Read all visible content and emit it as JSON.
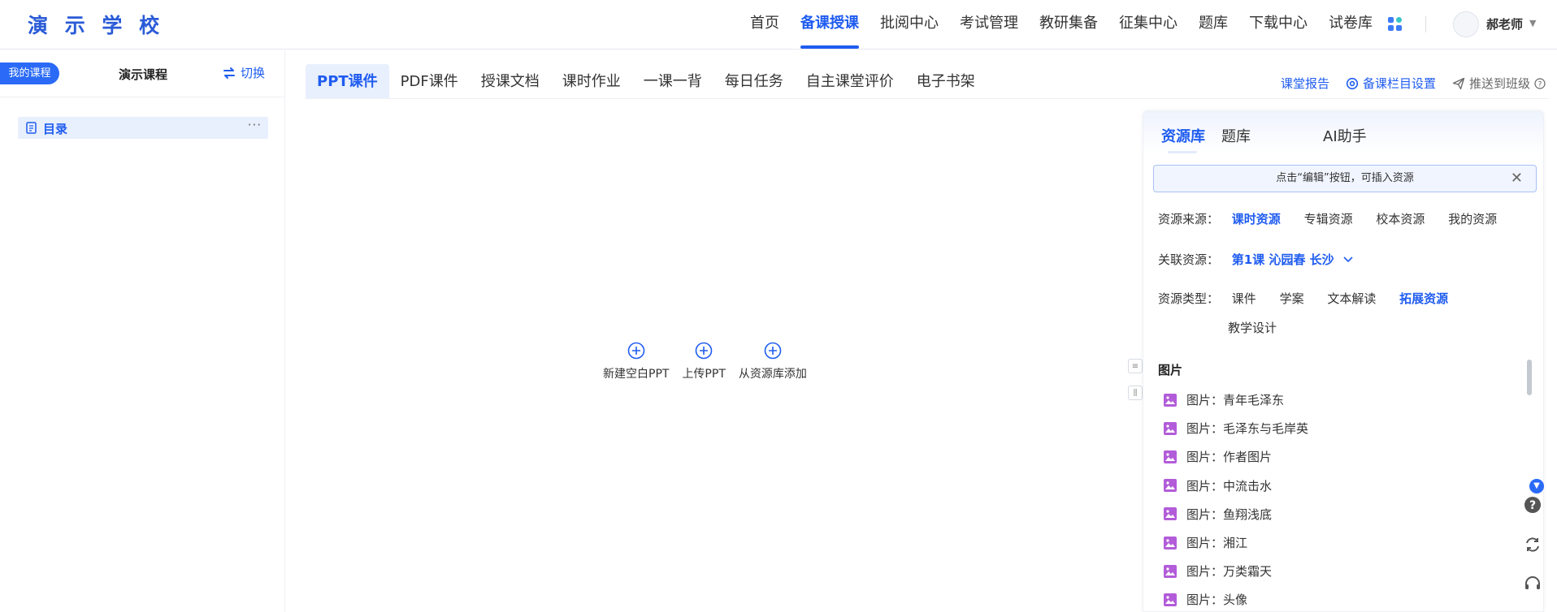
{
  "header": {
    "logo": "演 示 学 校",
    "nav": [
      "首页",
      "备课授课",
      "批阅中心",
      "考试管理",
      "教研集备",
      "征集中心",
      "题库",
      "下载中心",
      "试卷库"
    ],
    "active_nav": "备课授课",
    "user_name": "郝老师",
    "apps_icon": "apps-grid-icon"
  },
  "sidebar": {
    "my_course_badge": "我的课程",
    "course_name": "演示课程",
    "switch_label": "切换",
    "toc_label": "目录",
    "toc_more": "···"
  },
  "content_tabs": [
    "PPT课件",
    "PDF课件",
    "授课文档",
    "课时作业",
    "一课一背",
    "每日任务",
    "自主课堂评价",
    "电子书架"
  ],
  "active_tab": "PPT课件",
  "top_actions": {
    "report": "课堂报告",
    "settings": "备课栏目设置",
    "push": "推送到班级"
  },
  "empty_actions": [
    {
      "label": "新建空白PPT",
      "icon": "plus-circle-icon"
    },
    {
      "label": "上传PPT",
      "icon": "plus-circle-icon"
    },
    {
      "label": "从资源库添加",
      "icon": "plus-circle-icon"
    }
  ],
  "resource_panel": {
    "tabs": [
      "资源库",
      "题库",
      "AI助手"
    ],
    "active_tab": "资源库",
    "tip": "点击“编辑”按钮，可插入资源",
    "source": {
      "label": "资源来源：",
      "options": [
        "课时资源",
        "专辑资源",
        "校本资源",
        "我的资源"
      ],
      "active": "课时资源"
    },
    "related": {
      "label": "关联资源：",
      "value": "第1课 沁园春 长沙"
    },
    "type": {
      "label": "资源类型：",
      "options": [
        "课件",
        "学案",
        "文本解读",
        "拓展资源",
        "教学设计"
      ],
      "active": "拓展资源"
    },
    "section_title": "图片",
    "items": [
      "图片：青年毛泽东",
      "图片：毛泽东与毛岸英",
      "图片：作者图片",
      "图片：中流击水",
      "图片：鱼翔浅底",
      "图片：湘江",
      "图片：万类霜天",
      "图片：头像"
    ]
  },
  "colors": {
    "accent": "#1f5cf0",
    "image_icon": "#b25cd9"
  }
}
